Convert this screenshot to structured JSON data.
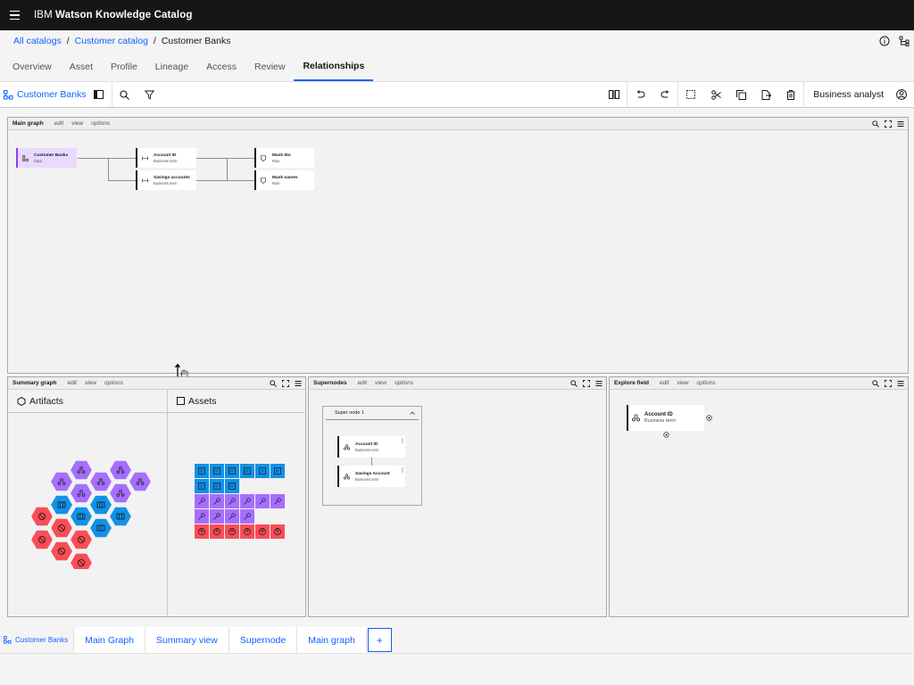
{
  "header": {
    "brand_prefix": "IBM",
    "brand_name": "Watson Knowledge Catalog"
  },
  "breadcrumb": {
    "items": [
      "All catalogs",
      "Customer catalog"
    ],
    "separator": "/",
    "current": "Customer Banks"
  },
  "tabs": [
    {
      "label": "Overview"
    },
    {
      "label": "Asset"
    },
    {
      "label": "Profile"
    },
    {
      "label": "Lineage"
    },
    {
      "label": "Access"
    },
    {
      "label": "Review"
    },
    {
      "label": "Relationships"
    }
  ],
  "active_tab": "Relationships",
  "toolbar": {
    "title": "Customer Banks",
    "user_role": "Business analyst"
  },
  "main_graph": {
    "title": "Main graph",
    "menus": [
      "edit",
      "view",
      "options"
    ],
    "nodes": [
      {
        "title": "Customer Banks",
        "subtitle": "Data"
      },
      {
        "title": "Account ID",
        "subtitle": "Business term"
      },
      {
        "title": "Savings accounts",
        "subtitle": "Business term"
      },
      {
        "title": "Mask IDs",
        "subtitle": "Rule"
      },
      {
        "title": "Mask names",
        "subtitle": "Rule"
      }
    ]
  },
  "summary_graph": {
    "title": "Summary graph",
    "menus": [
      "edit",
      "view",
      "options"
    ],
    "artifacts_label": "Artifacts",
    "assets_label": "Assets"
  },
  "supernodes": {
    "title": "Supernodes",
    "menus": [
      "edit",
      "view",
      "options"
    ],
    "super_node_label": "Super node 1",
    "nodes": [
      {
        "title": "Account ID",
        "subtitle": "Business term"
      },
      {
        "title": "Savings Account",
        "subtitle": "Business term"
      }
    ]
  },
  "explore_field": {
    "title": "Explore field",
    "menus": [
      "edit",
      "view",
      "options"
    ],
    "node": {
      "title": "Account ID",
      "subtitle": "Business term"
    }
  },
  "bottom_tabs": {
    "first": "Customer Banks",
    "items": [
      "Main Graph",
      "Summary view",
      "Supernode",
      "Main graph"
    ],
    "add": "+"
  },
  "colors": {
    "purple": "#a56eff",
    "blue": "#1192e8",
    "red": "#fa4d56",
    "link": "#0f62fe"
  }
}
